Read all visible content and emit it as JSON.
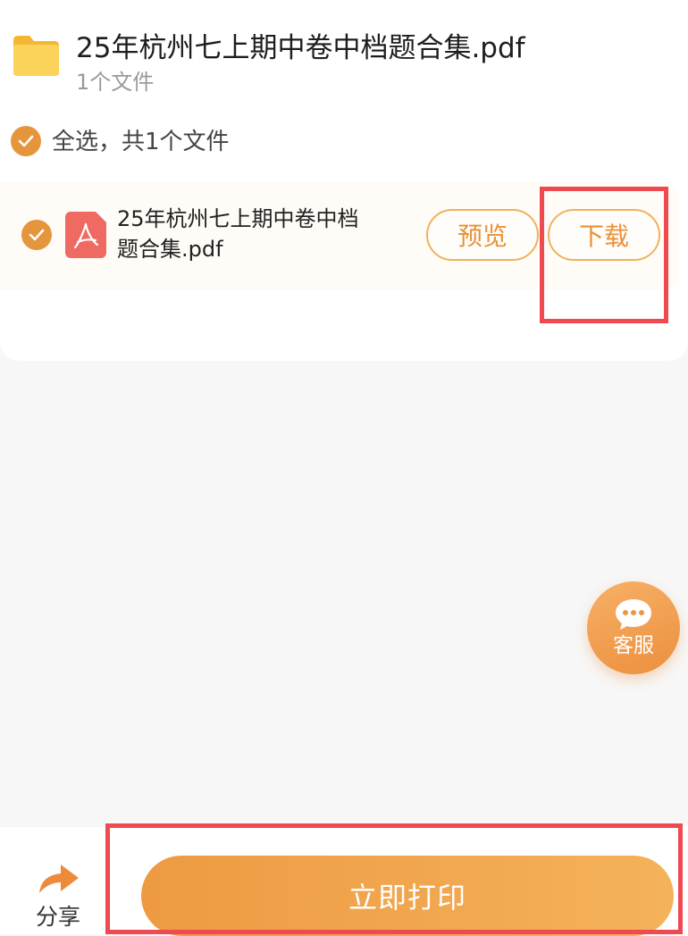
{
  "folder": {
    "title": "25年杭州七上期中卷中档题合集.pdf",
    "file_count": "1个文件"
  },
  "select_all": {
    "label": "全选，共1个文件",
    "checked": true
  },
  "files": [
    {
      "name": "25年杭州七上期中卷中档题合集.pdf",
      "checked": true,
      "preview_label": "预览",
      "download_label": "下载"
    }
  ],
  "service_button": {
    "label": "客服"
  },
  "bottom_bar": {
    "share_label": "分享",
    "print_label": "立即打印"
  },
  "colors": {
    "accent": "#e8913a",
    "highlight": "#ee4a50",
    "pdf_icon": "#ee6a63",
    "folder": "#f9c94e"
  }
}
